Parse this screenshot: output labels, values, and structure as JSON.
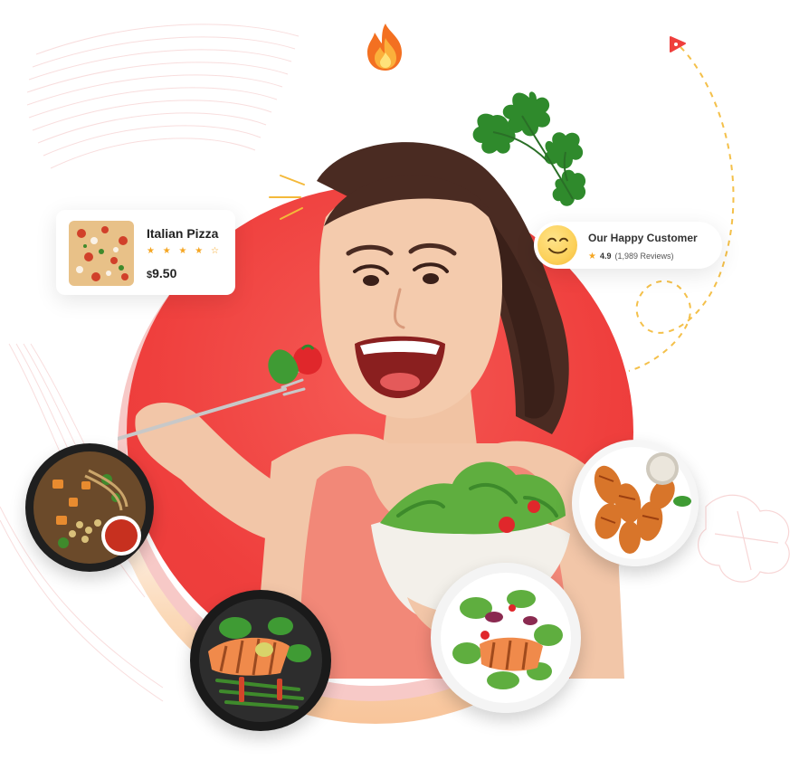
{
  "pizza_card": {
    "title": "Italian Pizza",
    "stars": "★ ★ ★ ★ ☆",
    "currency": "$",
    "price": "9.50"
  },
  "customer_card": {
    "title": "Our Happy Customer",
    "rating_star": "★",
    "rating": "4.9",
    "reviews": "(1,989 Reviews)"
  },
  "icons": {
    "fire": "fire-icon",
    "cilantro": "cilantro-leaf-icon",
    "play_arrow": "play-arrow-icon",
    "smile": "smile-face-icon"
  },
  "colors": {
    "primary_red": "#ef3f3d",
    "accent_orange": "#f8c49a",
    "star_yellow": "#f5a623",
    "dashed_line": "#f4c04a"
  }
}
